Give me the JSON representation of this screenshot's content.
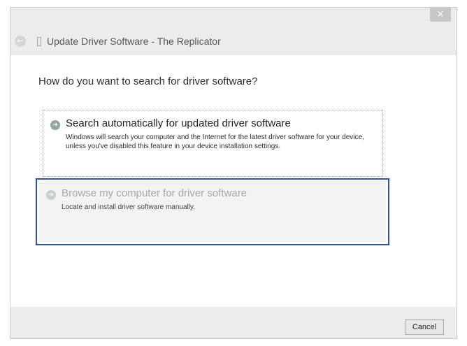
{
  "window": {
    "title": "Update Driver Software - The Replicator",
    "close_glyph": "×",
    "back_glyph": "←"
  },
  "main": {
    "heading": "How do you want to search for driver software?",
    "options": [
      {
        "title": "Search automatically for updated driver software",
        "description": "Windows will search your computer and the Internet for the latest driver software for your device, unless you've disabled this feature in your device installation settings.",
        "icon": "arrow-icon"
      },
      {
        "title": "Browse my computer for driver software",
        "description": "Locate and install driver software manually.",
        "icon": "arrow-icon"
      }
    ]
  },
  "footer": {
    "cancel_label": "Cancel"
  },
  "colors": {
    "focus_border": "#2c55a8",
    "dialog_background": "#ececec"
  }
}
